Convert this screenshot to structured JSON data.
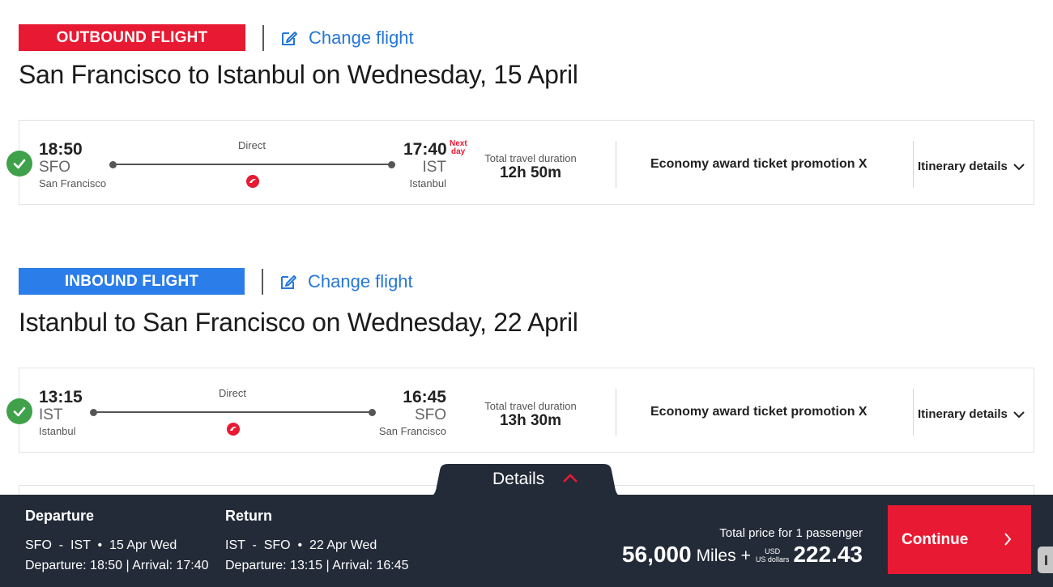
{
  "outbound": {
    "tag": "OUTBOUND FLIGHT",
    "change_label": "Change flight",
    "route_title": "San Francisco to Istanbul on Wednesday, 15 April",
    "dep_time": "18:50",
    "dep_code": "SFO",
    "dep_city": "San Francisco",
    "stop_label": "Direct",
    "arr_time": "17:40",
    "next_day_line1": "Next",
    "next_day_line2": "day",
    "arr_code": "IST",
    "arr_city": "Istanbul",
    "duration_label": "Total travel duration",
    "duration": "12h 50m",
    "fare": "Economy award ticket promotion X",
    "itinerary_label": "Itinerary details"
  },
  "inbound": {
    "tag": "INBOUND FLIGHT",
    "change_label": "Change flight",
    "route_title": "Istanbul to San Francisco on Wednesday, 22 April",
    "dep_time": "13:15",
    "dep_code": "IST",
    "dep_city": "Istanbul",
    "stop_label": "Direct",
    "arr_time": "16:45",
    "arr_code": "SFO",
    "arr_city": "San Francisco",
    "duration_label": "Total travel duration",
    "duration": "13h 30m",
    "fare": "Economy award ticket promotion X",
    "itinerary_label": "Itinerary details"
  },
  "summary": {
    "details_label": "Details",
    "departure_heading": "Departure",
    "departure_route": "SFO  -  IST  •  15 Apr Wed",
    "departure_times": "Departure: 18:50 | Arrival: 17:40",
    "return_heading": "Return",
    "return_route": "IST  -  SFO  •  22 Apr Wed",
    "return_times": "Departure: 13:15 | Arrival: 16:45",
    "total_label": "Total price for 1 passenger",
    "miles": "56,000",
    "miles_word": "Miles",
    "plus": "+",
    "currency_code": "USD",
    "currency_name": "US dollars",
    "amount": "222.43",
    "continue_label": "Continue"
  },
  "colors": {
    "brand_red": "#e81932",
    "inbound_blue": "#2b7de9",
    "link_blue": "#2577d8",
    "success_green": "#3fa14a",
    "summary_bar": "#232b38"
  },
  "icons": [
    "edit-icon",
    "check-icon",
    "airline-logo-icon",
    "chevron-down-icon",
    "chevron-up-icon",
    "chevron-right-icon"
  ]
}
